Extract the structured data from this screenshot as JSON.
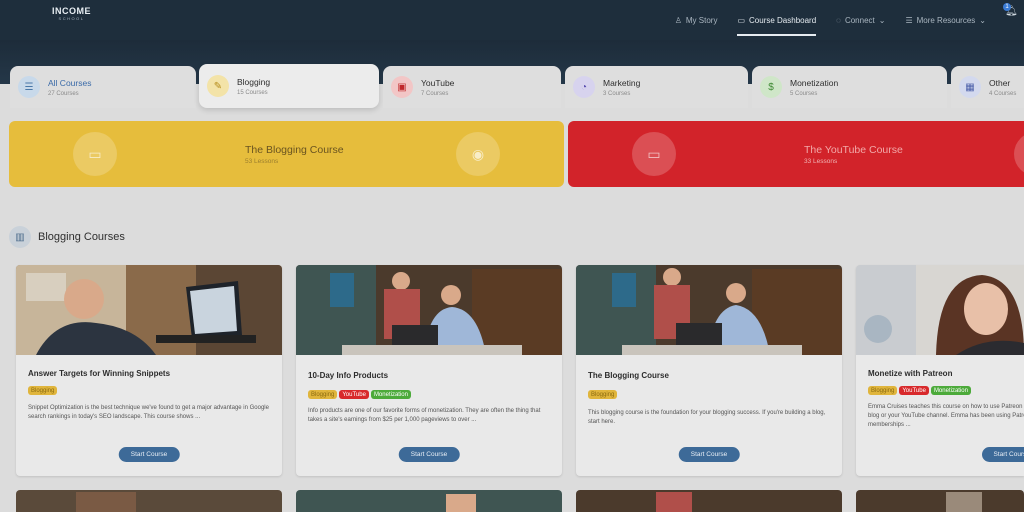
{
  "nav": {
    "logo_line1": "INCOME",
    "logo_line2": "SCHOOL",
    "links": [
      {
        "label": "My Story",
        "icon": "user-icon"
      },
      {
        "label": "Course Dashboard",
        "icon": "book-icon",
        "active": true
      },
      {
        "label": "Connect",
        "icon": "chat-icon",
        "caret": "⌄"
      },
      {
        "label": "More Resources",
        "icon": "list-icon",
        "caret": "⌄"
      }
    ],
    "notification_count": "1"
  },
  "tabs": [
    {
      "title": "All Courses",
      "sub": "27 Courses",
      "icon": "list-icon",
      "color": "#c8d9ea"
    },
    {
      "title": "Blogging",
      "sub": "15 Courses",
      "icon": "edit-icon",
      "color": "#f3e3a8"
    },
    {
      "title": "YouTube",
      "sub": "7 Courses",
      "icon": "youtube-icon",
      "color": "#f2c6c6"
    },
    {
      "title": "Marketing",
      "sub": "3 Courses",
      "icon": "pie-chart-icon",
      "color": "#d7d3ee"
    },
    {
      "title": "Monetization",
      "sub": "5 Courses",
      "icon": "dollar-icon",
      "color": "#cfe6c8"
    },
    {
      "title": "Other",
      "sub": "4 Courses",
      "icon": "grid-icon",
      "color": "#d3d9ee"
    }
  ],
  "banners": [
    {
      "title": "The Blogging Course",
      "sub": "53 Lessons",
      "color": "#e6bd3c",
      "text_color": "#6a5420",
      "sub_color": "#9c7f2e"
    },
    {
      "title": "The YouTube Course",
      "sub": "33 Lessons",
      "color": "#d2232a",
      "text_color": "#f2a8a8",
      "sub_color": "#f0b2b2"
    }
  ],
  "section": {
    "title": "Blogging Courses",
    "icon": "book-open-icon"
  },
  "cards": [
    {
      "title": "Answer Targets for Winning Snippets",
      "tags": [
        {
          "label": "Blogging",
          "kind": "blog"
        }
      ],
      "desc": "Snippet Optimization is the best technique we've found to get a major advantage in Google search rankings in today's SEO landscape. This course shows ...",
      "button": "Start Course"
    },
    {
      "title": "10-Day Info Products",
      "tags": [
        {
          "label": "Blogging",
          "kind": "blog"
        },
        {
          "label": "YouTube",
          "kind": "yt"
        },
        {
          "label": "Monetization",
          "kind": "mon"
        }
      ],
      "desc": "Info products are one of our favorite forms of monetization. They are often the thing that takes a site's earnings from $25 per 1,000 pageviews to over ...",
      "button": "Start Course"
    },
    {
      "title": "The Blogging Course",
      "tags": [
        {
          "label": "Blogging",
          "kind": "blog"
        }
      ],
      "desc": "This blogging course is the foundation for your blogging success. If you're building a blog, start here.",
      "button": "Start Course"
    },
    {
      "title": "Monetize with Patreon",
      "tags": [
        {
          "label": "Blogging",
          "kind": "blog"
        },
        {
          "label": "YouTube",
          "kind": "yt"
        },
        {
          "label": "Monetization",
          "kind": "mon"
        }
      ],
      "desc": "Emma Cruises teaches this course on how to use Patreon on your blog or your YouTube channel. Emma has been using Patreon memberships ...",
      "button": "Start Course"
    }
  ]
}
